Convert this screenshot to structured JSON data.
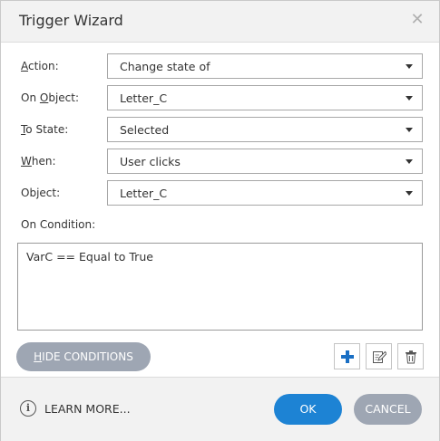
{
  "window": {
    "title": "Trigger Wizard",
    "close_glyph": "✕"
  },
  "fields": [
    {
      "label_key": "A",
      "label_rest": "ction:",
      "value": "Change state of"
    },
    {
      "label_pre": "On ",
      "label_key": "O",
      "label_rest": "bject:",
      "value": "Letter_C"
    },
    {
      "label_key": "T",
      "label_rest": "o State:",
      "value": "Selected"
    },
    {
      "label_key": "W",
      "label_rest": "hen:",
      "value": "User clicks"
    },
    {
      "label_pre": "Object:",
      "value": "Letter_C"
    }
  ],
  "conditions": {
    "label": "On Condition:",
    "text": "VarC == Equal to True"
  },
  "buttons": {
    "hide_conditions_key": "H",
    "hide_conditions_rest": "IDE CONDITIONS",
    "add_icon": "plus-icon",
    "edit_icon": "edit-icon",
    "delete_icon": "trash-icon"
  },
  "footer": {
    "info_glyph": "i",
    "learn_more": "LEARN MORE...",
    "ok": "OK",
    "cancel": "CANCEL"
  },
  "colors": {
    "ok_blue": "#1d83d4",
    "neutral_button": "#9ea6b3",
    "add_icon": "#1a6fc4"
  }
}
